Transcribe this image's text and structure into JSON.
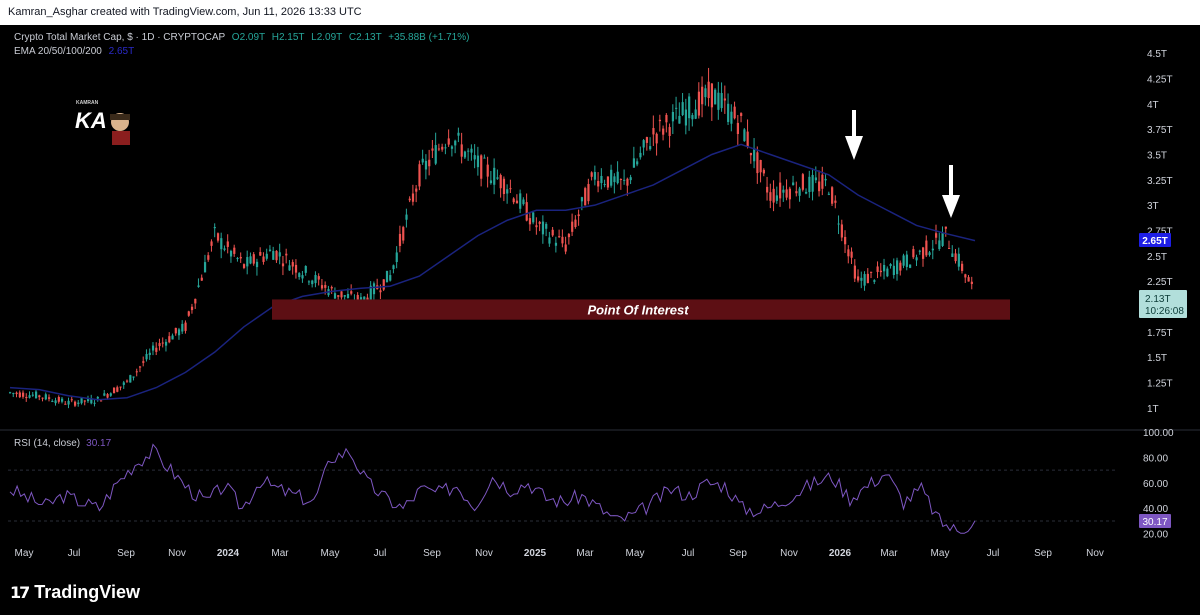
{
  "header": {
    "caption": "Kamran_Asghar created with TradingView.com, Jun 11, 2026 13:33 UTC"
  },
  "legend": {
    "symbol": "Crypto Total Market Cap, $ · 1D · CRYPTOCAP",
    "open": "O2.09T",
    "high": "H2.15T",
    "low": "L2.09T",
    "close": "C2.13T",
    "change": "+35.88B (+1.71%)",
    "ema_label": "EMA 20/50/100/200",
    "ema_value": "2.65T"
  },
  "rsi_legend": {
    "label": "RSI (14, close)",
    "value": "30.17"
  },
  "zone": {
    "label": "Point Of Interest"
  },
  "price_tag": {
    "price": "2.13T",
    "countdown": "10:26:08"
  },
  "ema_tag": "2.65T",
  "rsi_tag": "30.17",
  "footer": {
    "brand_mark": "17",
    "brand_text": "TradingView"
  },
  "avatar": {
    "initials": "KA",
    "caption": "KAMRAN"
  },
  "colors": {
    "up": "#26a69a",
    "down": "#ef5350",
    "ema": "#1a237e",
    "rsi": "#7e57c2",
    "zone": "#5d0f14",
    "ema_tag_bg": "#1e1ee6",
    "price_tag_bg": "#b2dfdb"
  },
  "chart_data": [
    {
      "type": "candlestick",
      "title": "Crypto Total Market Cap, $ · 1D · CRYPTOCAP",
      "y_ticks": [
        "4.5T",
        "4.25T",
        "4T",
        "3.75T",
        "3.5T",
        "3.25T",
        "3T",
        "2.75T",
        "2.5T",
        "2.25T",
        "2T",
        "1.75T",
        "1.5T",
        "1.25T",
        "1T"
      ],
      "x_ticks": [
        "May",
        "Jul",
        "Sep",
        "Nov",
        "2024",
        "Mar",
        "May",
        "Jul",
        "Sep",
        "Nov",
        "2025",
        "Mar",
        "May",
        "Jul",
        "Sep",
        "Nov",
        "2026",
        "Mar",
        "May",
        "Jul",
        "Sep",
        "Nov"
      ],
      "ylim": [
        0.92,
        4.6
      ],
      "x": [
        "2023-05",
        "2023-07",
        "2023-09",
        "2023-10",
        "2023-11",
        "2024-01",
        "2024-02",
        "2024-03",
        "2024-04",
        "2024-06",
        "2024-07",
        "2024-08",
        "2024-09",
        "2024-10",
        "2024-11",
        "2024-12",
        "2025-01",
        "2025-02",
        "2025-03",
        "2025-04",
        "2025-05",
        "2025-06",
        "2025-07",
        "2025-08",
        "2025-09",
        "2025-10",
        "2025-11",
        "2025-12",
        "2026-01",
        "2026-02",
        "2026-03",
        "2026-04",
        "2026-05",
        "2026-06"
      ],
      "series": [
        {
          "values": [
            1.15,
            1.12,
            1.05,
            1.08,
            1.25,
            1.6,
            1.8,
            2.7,
            2.4,
            2.55,
            2.35,
            2.15,
            2.05,
            2.3,
            3.3,
            3.7,
            3.4,
            3.2,
            2.8,
            2.6,
            3.3,
            3.2,
            3.7,
            3.9,
            4.1,
            3.8,
            3.1,
            3.2,
            3.2,
            2.25,
            2.35,
            2.5,
            2.7,
            2.13
          ]
        },
        {
          "values": [
            1.2,
            1.18,
            1.12,
            1.08,
            1.1,
            1.2,
            1.35,
            1.55,
            1.8,
            2.0,
            2.1,
            2.15,
            2.18,
            2.2,
            2.3,
            2.5,
            2.7,
            2.85,
            2.95,
            2.95,
            3.0,
            3.1,
            3.2,
            3.35,
            3.5,
            3.6,
            3.5,
            3.4,
            3.3,
            3.1,
            2.95,
            2.8,
            2.72,
            2.65
          ]
        }
      ],
      "annotations": [
        "Point Of Interest"
      ],
      "zone": [
        1.87,
        2.07
      ]
    },
    {
      "type": "line",
      "title": "RSI (14, close)",
      "y_ticks": [
        "100.00",
        "80.00",
        "60.00",
        "40.00",
        "20.00"
      ],
      "ylim": [
        15,
        100
      ],
      "series": [
        {
          "values": [
            55,
            48,
            42,
            50,
            45,
            40,
            60,
            75,
            85,
            70,
            55,
            45,
            58,
            40,
            62,
            55,
            50,
            45,
            80,
            85,
            60,
            48,
            40,
            55,
            52,
            58,
            42,
            65,
            55,
            60,
            48,
            45,
            50,
            40,
            30,
            35,
            45,
            55,
            50,
            60,
            58,
            40,
            38,
            44,
            52,
            60,
            65,
            48,
            58,
            68,
            45,
            55,
            30,
            22,
            30
          ]
        }
      ]
    }
  ]
}
